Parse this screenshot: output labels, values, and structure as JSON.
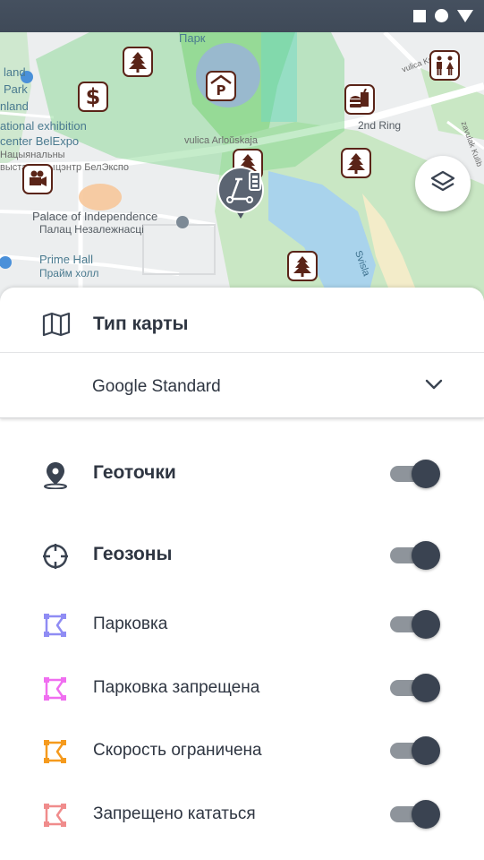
{
  "status_bar": {
    "icons": [
      "square-icon",
      "circle-icon",
      "triangle-icon"
    ]
  },
  "map": {
    "labels": {
      "park": "Парк",
      "park_left_1": "land",
      "park_left_2": "Park",
      "park_left_3": "nland",
      "exhibition_1": "ational exhibition",
      "exhibition_2": "center BelExpo",
      "exhibition_3": "Нацыянальны",
      "exhibition_4": "выставачны",
      "exhibition_5": "цэнтр БелЭкспо",
      "arlouskaja": "vulica Arloŭskaja",
      "second_ring": "2nd Ring",
      "palace_1": "Palace of Independence",
      "palace_2": "Палац Незалежнасці",
      "prime_hall_1": "Prime Hall",
      "prime_hall_2": "Прайм холл",
      "svisla": "Svisla",
      "street_top": "vulica Kulibina",
      "street_right": "zavulak Kulib"
    },
    "poi_icons": [
      "tree-icon",
      "dollar-icon",
      "parking-icon",
      "food-icon",
      "toilet-icon",
      "tree-icon",
      "camera-icon",
      "scooter-marker",
      "tree-icon"
    ],
    "layers_button_icon": "layers-icon"
  },
  "sheet": {
    "map_type": {
      "icon": "map-icon",
      "title": "Тип карты"
    },
    "select": {
      "value": "Google Standard",
      "icon": "chevron-down-icon"
    },
    "rows": [
      {
        "label": "Геоточки",
        "icon": "location-pin-icon",
        "on": true,
        "bold": true
      },
      {
        "label": "Геозоны",
        "icon": "crosshair-icon",
        "on": true,
        "bold": true
      },
      {
        "label": "Парковка",
        "icon": "zone-parking-icon",
        "color": "#8f8cf4",
        "on": true
      },
      {
        "label": "Парковка запрещена",
        "icon": "zone-no-parking-icon",
        "color": "#f06ef0",
        "on": true
      },
      {
        "label": "Скорость ограничена",
        "icon": "zone-speed-limit-icon",
        "color": "#f59a1d",
        "on": true
      },
      {
        "label": "Запрещено кататься",
        "icon": "zone-no-riding-icon",
        "color": "#f08c8c",
        "on": true
      }
    ]
  },
  "colors": {
    "text": "#2f3642",
    "toggle_knob": "#3a4351",
    "toggle_track": "#8e949b",
    "poi_border": "#5a2418"
  }
}
